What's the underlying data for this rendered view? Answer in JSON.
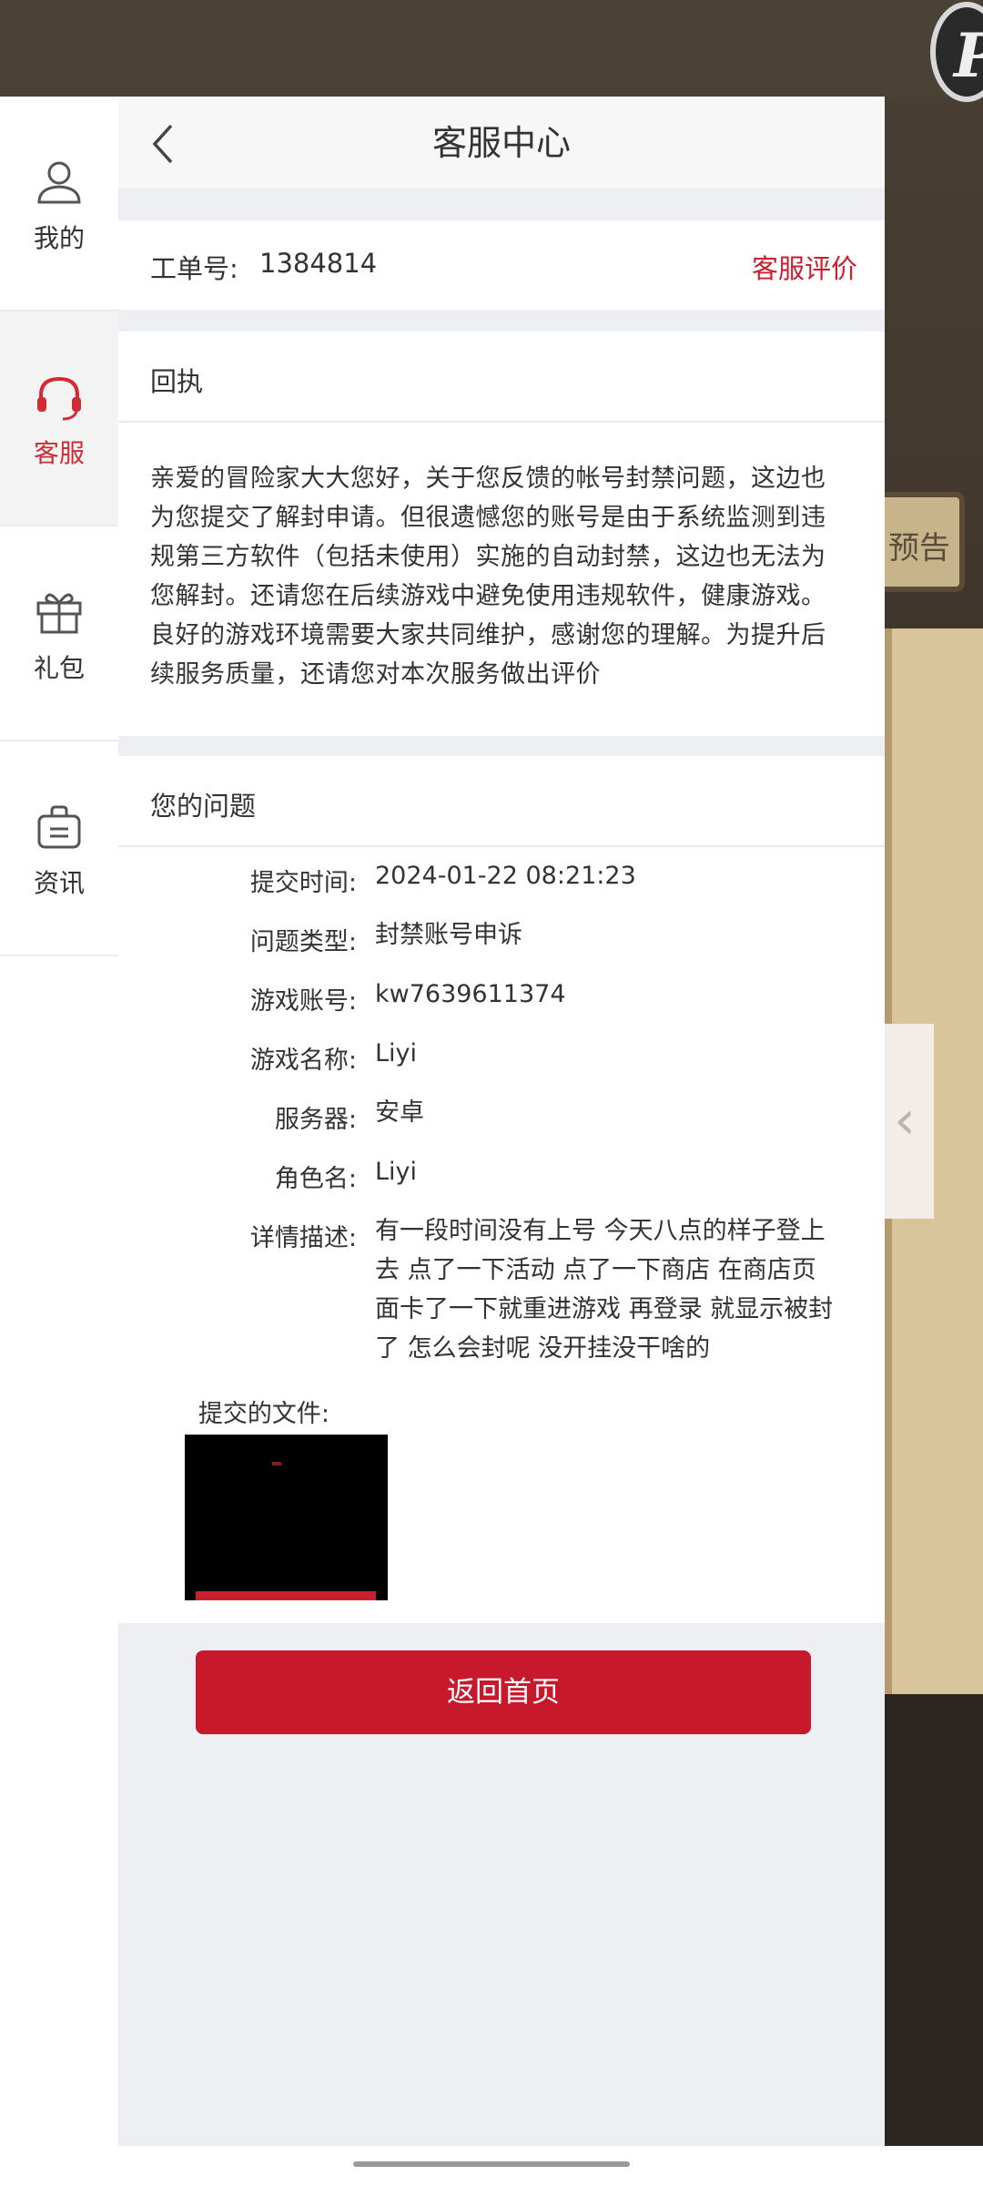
{
  "app": {
    "title": "客服中心"
  },
  "background": {
    "logo_letter": "P",
    "side_tab_text": "预告"
  },
  "nav": {
    "items": [
      {
        "label": "我的",
        "icon": "user-icon"
      },
      {
        "label": "客服",
        "icon": "headset-icon",
        "active": true
      },
      {
        "label": "礼包",
        "icon": "gift-icon"
      },
      {
        "label": "资讯",
        "icon": "news-bag-icon"
      }
    ]
  },
  "ticket": {
    "label": "工单号:",
    "number": "1384814",
    "rate_label": "客服评价"
  },
  "receipt": {
    "title": "回执",
    "text": "亲爱的冒险家大大您好，关于您反馈的帐号封禁问题，这边也为您提交了解封申请。但很遗憾您的账号是由于系统监测到违规第三方软件（包括未使用）实施的自动封禁，这边也无法为您解封。还请您在后续游戏中避免使用违规软件，健康游戏。良好的游戏环境需要大家共同维护，感谢您的理解。为提升后续服务质量，还请您对本次服务做出评价"
  },
  "question": {
    "title": "您的问题",
    "fields": [
      {
        "label": "提交时间:",
        "value": "2024-01-22 08:21:23"
      },
      {
        "label": "问题类型:",
        "value": "封禁账号申诉"
      },
      {
        "label": "游戏账号:",
        "value": "kw7639611374"
      },
      {
        "label": "游戏名称:",
        "value": "Liyi"
      },
      {
        "label": "服务器:",
        "value": "安卓"
      },
      {
        "label": "角色名:",
        "value": "Liyi"
      },
      {
        "label": "详情描述:",
        "value": "有一段时间没有上号 今天八点的样子登上去 点了一下活动 点了一下商店 在商店页面卡了一下就重进游戏 再登录 就显示被封了 怎么会封呢 没开挂没干啥的"
      }
    ],
    "files_label": "提交的文件:"
  },
  "actions": {
    "home_label": "返回首页"
  },
  "colors": {
    "accent": "#c8192c",
    "link_red": "#c8202f"
  }
}
